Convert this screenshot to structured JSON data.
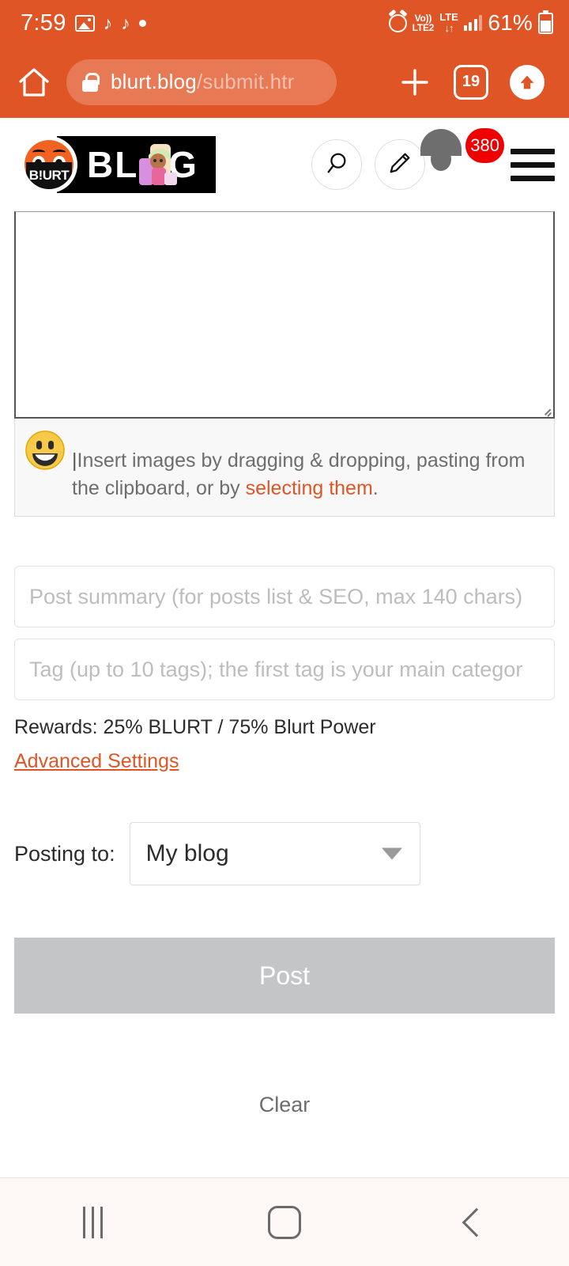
{
  "statusbar": {
    "time": "7:59",
    "icons_left": [
      "image-icon",
      "music-note-icon",
      "music-note-icon",
      "dot-icon"
    ],
    "alarm": "alarm-icon",
    "volte_top": "Vo))",
    "volte_bottom": "LTE2",
    "lte_label": "LTE",
    "lte_arrows": "↓↑",
    "battery_percent": "61%",
    "signal": "signal-bars-icon"
  },
  "browser": {
    "home_icon": "home-icon",
    "lock_icon": "lock-icon",
    "url_domain": "blurt.blog",
    "url_path": "/submit.htr",
    "new_tab_label": "+",
    "tab_count": "19",
    "upload_icon": "upload-arrow-icon"
  },
  "header": {
    "logo_badge_text": "B!URT",
    "logo_word": "BL",
    "logo_word_end": "G",
    "search_icon": "search-icon",
    "edit_icon": "pencil-icon",
    "avatar": "avatar-icon",
    "notification_count": "380",
    "menu_icon": "hamburger-menu-icon"
  },
  "editor": {
    "body_value": "",
    "hint_cursor": "|",
    "hint_text_before": "Insert images by dragging & dropping, pasting from the clipboard, or by ",
    "hint_link": "selecting them",
    "hint_text_after": ".",
    "emoji": "grinning-face-emoji"
  },
  "form": {
    "summary_placeholder": "Post summary (for posts list & SEO, max 140 chars)",
    "summary_value": "",
    "tag_placeholder": "Tag (up to 10 tags); the first tag is your main categor",
    "tag_value": "",
    "rewards_label": "Rewards: 25% BLURT / 75% Blurt Power",
    "advanced_settings_label": "Advanced Settings",
    "posting_to_label": "Posting to:",
    "posting_to_value": "My blog",
    "posting_to_options": [
      "My blog"
    ],
    "post_button_label": "Post",
    "clear_label": "Clear"
  },
  "navbar": {
    "recents": "recents-icon",
    "home": "home-icon",
    "back": "back-icon"
  },
  "colors": {
    "brand_orange": "#e05526",
    "link_orange": "#e05526",
    "badge_red": "#ee0000",
    "disabled_gray": "#c3c5c7"
  }
}
